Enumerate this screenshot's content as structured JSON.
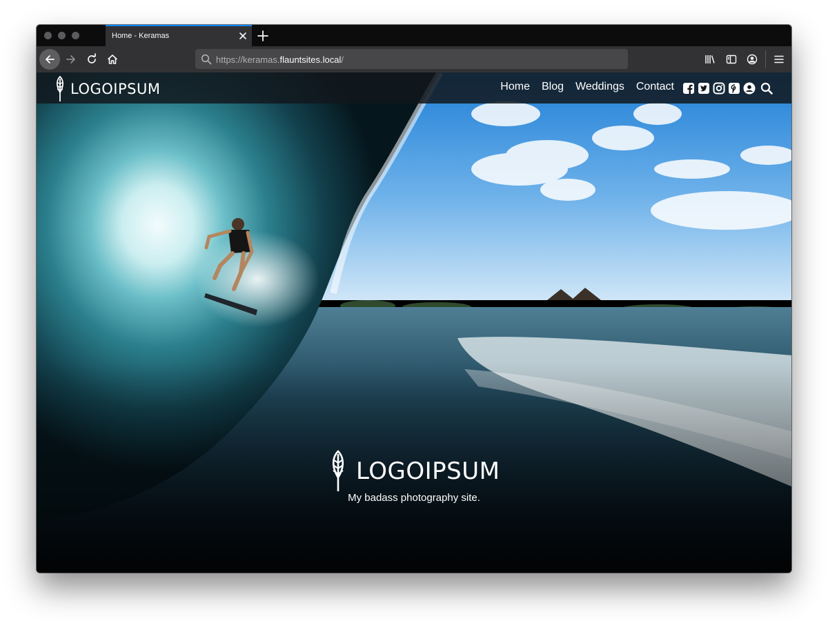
{
  "browser": {
    "tab_title": "Home - Keramas",
    "url_prefix": "https://keramas.",
    "url_host": "flauntsites.local",
    "url_suffix": "/"
  },
  "icons": {
    "window_controls": [
      "close-dot",
      "minimize-dot",
      "maximize-dot"
    ],
    "toolbar": [
      "back-icon",
      "forward-icon",
      "reload-icon",
      "home-icon",
      "search-icon",
      "library-icon",
      "sidebar-icon",
      "account-icon",
      "menu-icon"
    ],
    "social": [
      "facebook-icon",
      "twitter-icon",
      "instagram-icon",
      "pinterest-icon",
      "user-icon"
    ]
  },
  "site": {
    "logo_text": "LOGOIPSUM",
    "nav": [
      {
        "label": "Home"
      },
      {
        "label": "Blog"
      },
      {
        "label": "Weddings"
      },
      {
        "label": "Contact"
      }
    ],
    "hero_logo_text": "LOGOIPSUM",
    "tagline": "My badass photography site."
  },
  "colors": {
    "browser_chrome": "#323234",
    "tab_accent": "#0a84ff",
    "header_overlay": "#12181d",
    "text_light": "#ffffff"
  }
}
